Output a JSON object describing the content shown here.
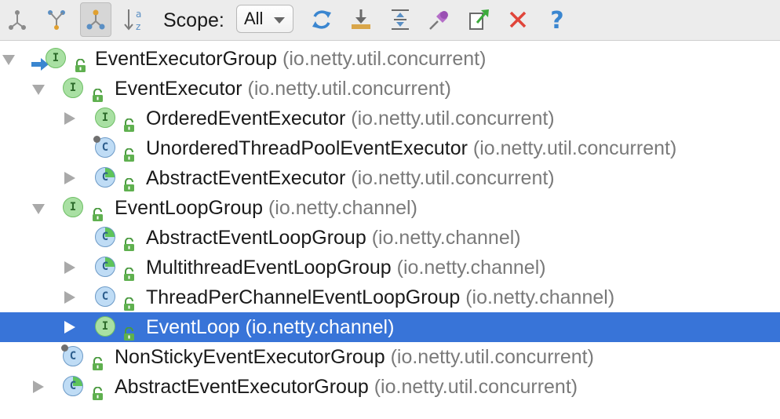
{
  "toolbar": {
    "scope_label": "Scope:",
    "scope_value": "All",
    "buttons": [
      {
        "icon": "supertype-hierarchy-icon"
      },
      {
        "icon": "subtype-hierarchy-icon"
      },
      {
        "icon": "class-hierarchy-icon",
        "active": true
      },
      {
        "icon": "sort-alphabetically-icon"
      },
      {
        "icon": "refresh-icon"
      },
      {
        "icon": "export-icon"
      },
      {
        "icon": "expand-all-icon"
      },
      {
        "icon": "pin-icon"
      },
      {
        "icon": "open-in-tool-window-icon"
      },
      {
        "icon": "close-icon"
      },
      {
        "icon": "help-icon"
      }
    ]
  },
  "tree": {
    "rows": [
      {
        "name": "EventExecutorGroup",
        "pkg": "(io.netty.util.concurrent)",
        "kind": "interface",
        "expanded": true,
        "is_base": true
      },
      {
        "name": "EventExecutor",
        "pkg": "(io.netty.util.concurrent)",
        "kind": "interface",
        "expanded": true
      },
      {
        "name": "OrderedEventExecutor",
        "pkg": "(io.netty.util.concurrent)",
        "kind": "interface",
        "expanded": false
      },
      {
        "name": "UnorderedThreadPoolEventExecutor",
        "pkg": "(io.netty.util.concurrent)",
        "kind": "class",
        "leaf": true
      },
      {
        "name": "AbstractEventExecutor",
        "pkg": "(io.netty.util.concurrent)",
        "kind": "abstract-class",
        "expanded": false
      },
      {
        "name": "EventLoopGroup",
        "pkg": "(io.netty.channel)",
        "kind": "interface",
        "expanded": true
      },
      {
        "name": "AbstractEventLoopGroup",
        "pkg": "(io.netty.channel)",
        "kind": "abstract-class",
        "leaf": true
      },
      {
        "name": "MultithreadEventLoopGroup",
        "pkg": "(io.netty.channel)",
        "kind": "abstract-class",
        "expanded": false
      },
      {
        "name": "ThreadPerChannelEventLoopGroup",
        "pkg": "(io.netty.channel)",
        "kind": "class",
        "expanded": false
      },
      {
        "name": "EventLoop",
        "pkg": "(io.netty.channel)",
        "kind": "interface",
        "expanded": false,
        "selected": true
      },
      {
        "name": "NonStickyEventExecutorGroup",
        "pkg": "(io.netty.util.concurrent)",
        "kind": "class",
        "leaf": true
      },
      {
        "name": "AbstractEventExecutorGroup",
        "pkg": "(io.netty.util.concurrent)",
        "kind": "abstract-class",
        "expanded": false
      }
    ]
  },
  "colors": {
    "selection": "#3874d8",
    "package_text": "#7a7a7a",
    "interface_badge": "#a9e0a3",
    "class_badge": "#bfdcf5"
  }
}
